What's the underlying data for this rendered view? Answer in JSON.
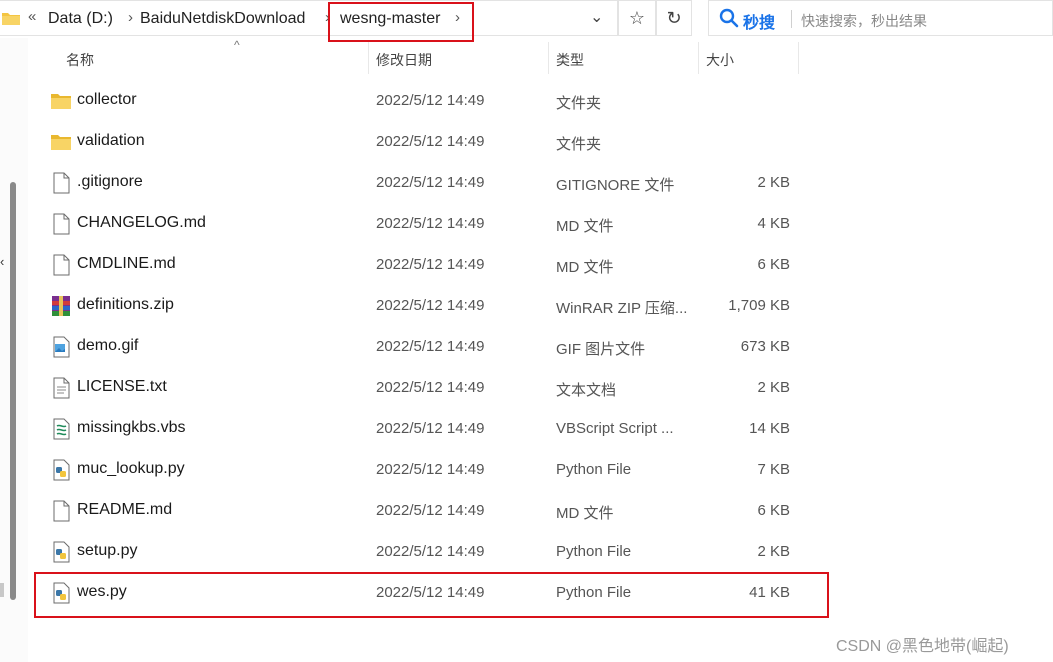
{
  "address_bar": {
    "crumbs": [
      "Data (D:)",
      "BaiduNetdiskDownload",
      "wesng-master"
    ],
    "overflow_glyph": "«"
  },
  "search": {
    "brand": "秒搜",
    "placeholder": "快速搜索，秒出结果"
  },
  "columns": {
    "name": "名称",
    "date": "修改日期",
    "type": "类型",
    "size": "大小"
  },
  "files": [
    {
      "name": "collector",
      "date": "2022/5/12 14:49",
      "type": "文件夹",
      "size": "",
      "icon": "folder"
    },
    {
      "name": "validation",
      "date": "2022/5/12 14:49",
      "type": "文件夹",
      "size": "",
      "icon": "folder"
    },
    {
      "name": ".gitignore",
      "date": "2022/5/12 14:49",
      "type": "GITIGNORE 文件",
      "size": "2 KB",
      "icon": "file"
    },
    {
      "name": "CHANGELOG.md",
      "date": "2022/5/12 14:49",
      "type": "MD 文件",
      "size": "4 KB",
      "icon": "file"
    },
    {
      "name": "CMDLINE.md",
      "date": "2022/5/12 14:49",
      "type": "MD 文件",
      "size": "6 KB",
      "icon": "file"
    },
    {
      "name": "definitions.zip",
      "date": "2022/5/12 14:49",
      "type": "WinRAR ZIP 压缩...",
      "size": "1,709 KB",
      "icon": "zip"
    },
    {
      "name": "demo.gif",
      "date": "2022/5/12 14:49",
      "type": "GIF 图片文件",
      "size": "673 KB",
      "icon": "image"
    },
    {
      "name": "LICENSE.txt",
      "date": "2022/5/12 14:49",
      "type": "文本文档",
      "size": "2 KB",
      "icon": "text"
    },
    {
      "name": "missingkbs.vbs",
      "date": "2022/5/12 14:49",
      "type": "VBScript Script ...",
      "size": "14 KB",
      "icon": "vbs"
    },
    {
      "name": "muc_lookup.py",
      "date": "2022/5/12 14:49",
      "type": "Python File",
      "size": "7 KB",
      "icon": "python"
    },
    {
      "name": "README.md",
      "date": "2022/5/12 14:49",
      "type": "MD 文件",
      "size": "6 KB",
      "icon": "file"
    },
    {
      "name": "setup.py",
      "date": "2022/5/12 14:49",
      "type": "Python File",
      "size": "2 KB",
      "icon": "python"
    },
    {
      "name": "wes.py",
      "date": "2022/5/12 14:49",
      "type": "Python File",
      "size": "41 KB",
      "icon": "python"
    }
  ],
  "watermark": "CSDN @黑色地带(崛起)",
  "colors": {
    "highlight": "#d9111a",
    "folder": "#f4c542",
    "accent": "#1a73e8"
  }
}
